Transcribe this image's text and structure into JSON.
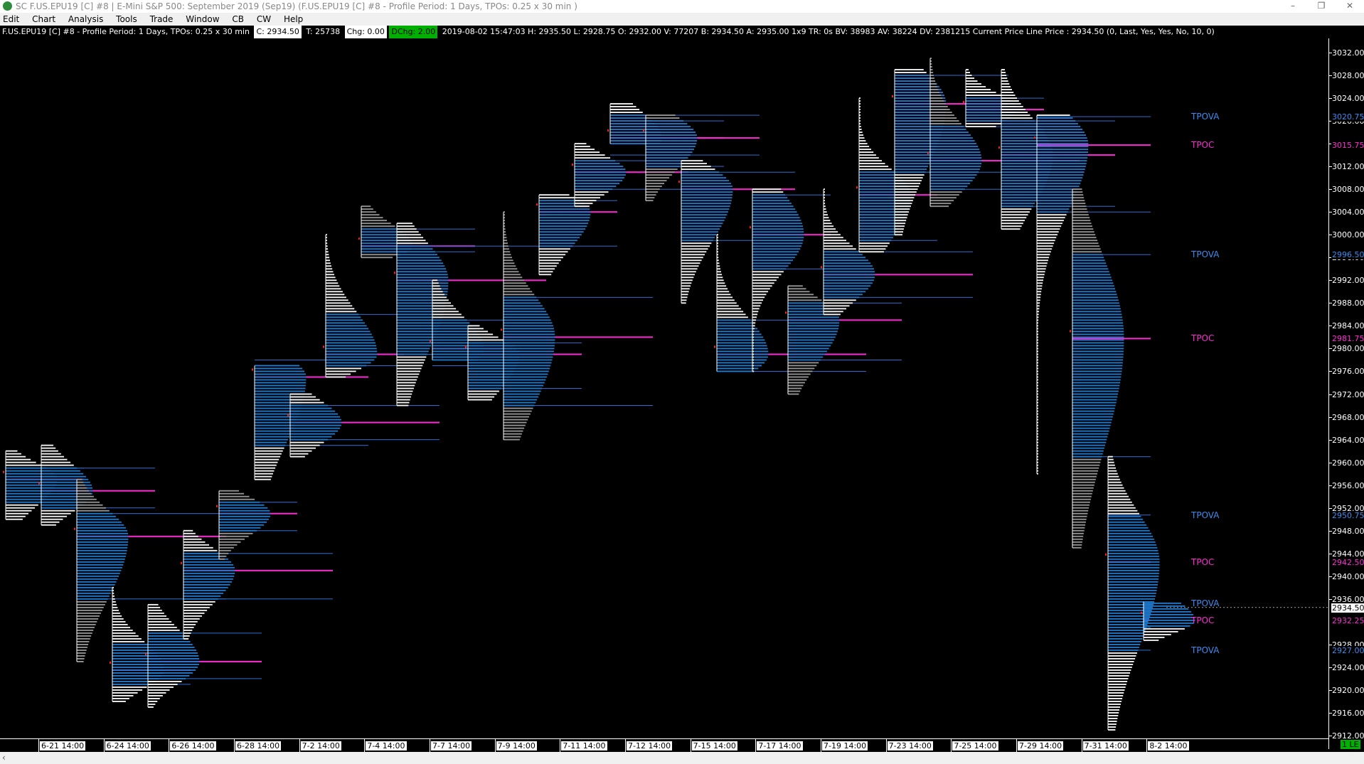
{
  "window": {
    "title": "SC F.US.EPU19 [C]  #8 | E-Mini S&P 500: September 2019 (Sep19) (F.US.EPU19 [C]  #8 - Profile Period: 1 Days, TPOs: 0.25 x 30 min  )",
    "minimize": "–",
    "restore": "❐",
    "close": "✕"
  },
  "menu": [
    "Edit",
    "Chart",
    "Analysis",
    "Tools",
    "Trade",
    "Window",
    "CB",
    "CW",
    "Help"
  ],
  "infobar": {
    "symbol": "F.US.EPU19 [C]  #8 - Profile Period: 1 Days, TPOs: 0.25 x 30 min",
    "close": "C: 2934.50",
    "trades": "T: 25738",
    "chg": "Chg: 0.00",
    "dchg": "DChg: 2.00",
    "rest": "2019-08-02 15:47:03 H: 2935.50 L: 2928.75 O: 2932.00 V: 77207 B: 2934.50 A: 2935.00 1x9 TR: 0s BV: 38983 AV: 38224 DV: 2381215 Current Price Line  Price        : 2934.50   (0, Last, Yes, Yes, No, 10, 0)"
  },
  "colors": {
    "background": "#000000",
    "profile_blue": "#1f7fd8",
    "profile_white": "#ffffff",
    "profile_gray": "#9a9a9a",
    "poc": "#ff2bd6",
    "va_line": "#2a6ed2",
    "grid_white": "#cfcfcf",
    "accent_green": "#00b000"
  },
  "yaxis": {
    "ticks": [
      "3032.00",
      "3028.00",
      "3024.00",
      "3020.00",
      "3016.00",
      "3012.00",
      "3008.00",
      "3004.00",
      "3000.00",
      "2996.00",
      "2992.00",
      "2988.00",
      "2984.00",
      "2980.00",
      "2976.00",
      "2972.00",
      "2968.00",
      "2964.00",
      "2960.00",
      "2956.00",
      "2952.00",
      "2948.00",
      "2944.00",
      "2940.00",
      "2936.00",
      "2928.00",
      "2924.00",
      "2920.00",
      "2916.00",
      "2912.00"
    ],
    "labels": [
      {
        "text": "3020.75",
        "kind": "va"
      },
      {
        "text": "3015.75",
        "kind": "poc"
      },
      {
        "text": "2996.50",
        "kind": "va"
      },
      {
        "text": "2981.75",
        "kind": "poc"
      },
      {
        "text": "2950.75",
        "kind": "va"
      },
      {
        "text": "2942.50",
        "kind": "poc"
      },
      {
        "text": "2934.50",
        "kind": "price"
      },
      {
        "text": "2932.25",
        "kind": "poc"
      },
      {
        "text": "2927.00",
        "kind": "va"
      }
    ]
  },
  "value_labels": [
    {
      "text": "TPOVA",
      "kind": "va",
      "price": 3020.75
    },
    {
      "text": "TPOC",
      "kind": "poc",
      "price": 3015.75
    },
    {
      "text": "TPOVA",
      "kind": "va",
      "price": 2996.5
    },
    {
      "text": "TPOC",
      "kind": "poc",
      "price": 2981.75
    },
    {
      "text": "TPOVA",
      "kind": "va",
      "price": 2950.75
    },
    {
      "text": "TPOC",
      "kind": "poc",
      "price": 2942.5
    },
    {
      "text": "TPOVA",
      "kind": "va",
      "price": 2935.25
    },
    {
      "text": "TPOC",
      "kind": "poc",
      "price": 2932.25
    },
    {
      "text": "TPOVA",
      "kind": "va",
      "price": 2927.0
    }
  ],
  "xaxis": {
    "labels": [
      "6-21  14:00",
      "6-24  14:00",
      "6-26  14:00",
      "6-28  14:00",
      "7-2  14:00",
      "7-4  14:00",
      "7-7  14:00",
      "7-9  14:00",
      "7-11  14:00",
      "7-12  14:00",
      "7-15  14:00",
      "7-17  14:00",
      "7-19  14:00",
      "7-23  14:00",
      "7-25  14:00",
      "7-29  14:00",
      "7-31  14:00",
      "8-2  14:00"
    ],
    "corner": "1 LE"
  },
  "chart_data": {
    "type": "market-profile",
    "y_range": [
      2911.5,
      3034.5
    ],
    "current_price": 2934.5,
    "profiles": [
      {
        "low": 2950,
        "high": 2962,
        "poc": 2957,
        "vah": 2959,
        "val": 2953
      },
      {
        "low": 2949,
        "high": 2963,
        "poc": 2955,
        "vah": 2959,
        "val": 2952
      },
      {
        "low": 2925,
        "high": 2957,
        "poc": 2947,
        "vah": 2951,
        "val": 2936
      },
      {
        "low": 2918,
        "high": 2938,
        "poc": 2923.5,
        "vah": 2928,
        "val": 2921
      },
      {
        "low": 2917,
        "high": 2935,
        "poc": 2925,
        "vah": 2930,
        "val": 2922
      },
      {
        "low": 2929,
        "high": 2948,
        "poc": 2941,
        "vah": 2944,
        "val": 2936
      },
      {
        "low": 2943,
        "high": 2955,
        "poc": 2951,
        "vah": 2953,
        "val": 2948
      },
      {
        "low": 2957,
        "high": 2977,
        "poc": 2975,
        "vah": 2978,
        "val": 2963
      },
      {
        "low": 2961,
        "high": 2972,
        "poc": 2967,
        "vah": 2970,
        "val": 2964
      },
      {
        "low": 2975,
        "high": 3000,
        "poc": 2979,
        "vah": 2986,
        "val": 2977
      },
      {
        "low": 2996,
        "high": 3005,
        "poc": 2998,
        "vah": 3001,
        "val": 2997
      },
      {
        "low": 2970,
        "high": 3002,
        "poc": 2992,
        "vah": 2998,
        "val": 2979
      },
      {
        "low": 2978,
        "high": 2992,
        "poc": 2980,
        "vah": 2985,
        "val": 2977
      },
      {
        "low": 2971,
        "high": 2984,
        "poc": 2979,
        "vah": 2981,
        "val": 2973
      },
      {
        "low": 2964,
        "high": 3004,
        "poc": 2982,
        "vah": 2989,
        "val": 2970
      },
      {
        "low": 2993,
        "high": 3007,
        "poc": 3004,
        "vah": 3006,
        "val": 2998
      },
      {
        "low": 3005,
        "high": 3016,
        "poc": 3011,
        "vah": 3013,
        "val": 3008
      },
      {
        "low": 3016,
        "high": 3023,
        "poc": 3017,
        "vah": 3021,
        "val": 3014
      },
      {
        "low": 3006,
        "high": 3021,
        "poc": 3017,
        "vah": 3020,
        "val": 3012
      },
      {
        "low": 2988,
        "high": 3013,
        "poc": 3008,
        "vah": 3011,
        "val": 2999
      },
      {
        "low": 2976,
        "high": 3000,
        "poc": 2979,
        "vah": 2985,
        "val": 2976
      },
      {
        "low": 2976,
        "high": 3008,
        "poc": 3000,
        "vah": 3007,
        "val": 2994
      },
      {
        "low": 2972,
        "high": 2991,
        "poc": 2985,
        "vah": 2988,
        "val": 2978
      },
      {
        "low": 2986,
        "high": 3008,
        "poc": 2993,
        "vah": 2997,
        "val": 2989
      },
      {
        "low": 2997,
        "high": 3024,
        "poc": 3007,
        "vah": 3011,
        "val": 2999
      },
      {
        "low": 3000,
        "high": 3029,
        "poc": 3023,
        "vah": 3028,
        "val": 3011
      },
      {
        "low": 3005,
        "high": 3031,
        "poc": 3013,
        "vah": 3019,
        "val": 3008
      },
      {
        "low": 3019,
        "high": 3029,
        "poc": 3022,
        "vah": 3024,
        "val": 3020
      },
      {
        "low": 3001,
        "high": 3029,
        "poc": 3014,
        "vah": 3020,
        "val": 3005
      },
      {
        "low": 2958,
        "high": 3021,
        "poc": 3015.75,
        "vah": 3020.75,
        "val": 3004
      },
      {
        "low": 2945,
        "high": 3008,
        "poc": 2981.75,
        "vah": 2996.5,
        "val": 2961
      },
      {
        "low": 2913,
        "high": 2961,
        "poc": 2942.5,
        "vah": 2950.75,
        "val": 2927
      },
      {
        "low": 2928.75,
        "high": 2935.5,
        "poc": 2932.25,
        "vah": 2935.25,
        "val": 2931
      }
    ]
  }
}
